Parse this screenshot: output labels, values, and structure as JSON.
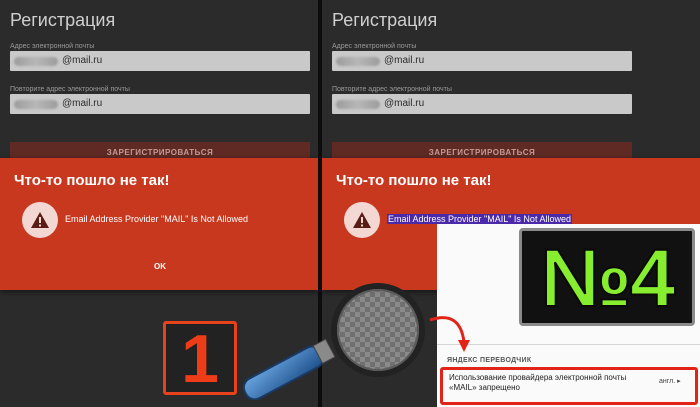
{
  "left_screen": {
    "title": "Регистрация",
    "email_label": "Адрес электронной почты",
    "email_domain": "@mail.ru",
    "repeat_label": "Повторите адрес электронной почты",
    "repeat_domain": "@mail.ru",
    "register_button": "ЗАРЕГИСТРИРОВАТЬСЯ",
    "dialog_title": "Что-то пошло не так!",
    "error_message": "Email Address Provider \"MAIL\" Is Not Allowed",
    "ok_button": "OK"
  },
  "right_screen": {
    "title": "Регистрация",
    "email_label": "Адрес электронной почты",
    "email_domain": "@mail.ru",
    "repeat_label": "Повторите адрес электронной почты",
    "repeat_domain": "@mail.ru",
    "register_button": "ЗАРЕГИСТРИРОВАТЬСЯ",
    "dialog_title": "Что-то пошло не так!",
    "error_message": "Email Address Provider \"MAIL\" Is Not Allowed"
  },
  "translator": {
    "header": "ЯНДЕКС ПЕРЕВОДЧИК",
    "line1": "Использование провайдера электронной почты",
    "line2": "«MAIL» запрещено",
    "lang": "англ. ▸"
  },
  "overlays": {
    "badge_1": "1",
    "badge_4": "№4"
  },
  "colors": {
    "dialog": "#c8381f",
    "highlight": "#4a2aa8",
    "badge_green": "#86ee2f",
    "badge_red": "#e8421c"
  },
  "icons": [
    "warning-icon",
    "magnifier-icon",
    "arrow-icon"
  ]
}
